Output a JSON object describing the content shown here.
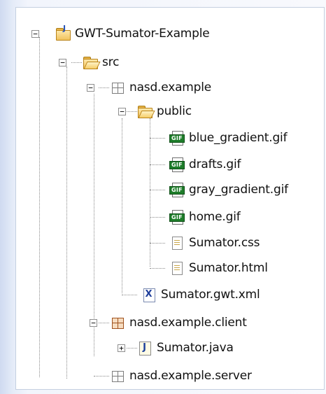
{
  "tree": {
    "root": {
      "label": "GWT-Sumator-Example",
      "expander": "−",
      "icon": "java-project-folder-icon"
    },
    "src": {
      "label": "src",
      "expander": "−",
      "icon": "source-folder-icon"
    },
    "pkg": {
      "label": "nasd.example",
      "expander": "−",
      "icon": "package-icon"
    },
    "public": {
      "label": "public",
      "expander": "−",
      "icon": "open-folder-icon"
    },
    "files": [
      {
        "label": "blue_gradient.gif",
        "icon": "gif-file-icon"
      },
      {
        "label": "drafts.gif",
        "icon": "gif-file-icon"
      },
      {
        "label": "gray_gradient.gif",
        "icon": "gif-file-icon"
      },
      {
        "label": "home.gif",
        "icon": "gif-file-icon"
      },
      {
        "label": "Sumator.css",
        "icon": "text-file-icon"
      },
      {
        "label": "Sumator.html",
        "icon": "text-file-icon"
      }
    ],
    "gwtxml": {
      "label": "Sumator.gwt.xml",
      "icon": "xml-file-icon",
      "icon_glyph": "X"
    },
    "client": {
      "label": "nasd.example.client",
      "expander": "−",
      "icon": "package-icon"
    },
    "java": {
      "label": "Sumator.java",
      "expander": "+",
      "icon": "java-file-icon",
      "icon_glyph": "J"
    },
    "server": {
      "label": "nasd.example.server",
      "icon": "package-icon"
    },
    "gif_tag": "GIF"
  },
  "colors": {
    "background_edge": "#cfdaf0",
    "panel": "#ffffff",
    "gif_badge": "#1e7d2a",
    "package_brown": "#a0521d"
  }
}
